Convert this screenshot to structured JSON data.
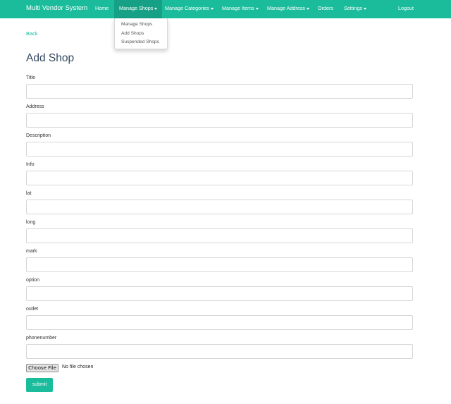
{
  "navbar": {
    "brand": "Multi Vendor System",
    "items": [
      {
        "label": "Home",
        "dropdown": false
      },
      {
        "label": "Manage Shops",
        "dropdown": true,
        "active": true
      },
      {
        "label": "Manage Categories",
        "dropdown": true
      },
      {
        "label": "Manage Items",
        "dropdown": true
      },
      {
        "label": "Manage Address",
        "dropdown": true
      },
      {
        "label": "Orders",
        "dropdown": false
      },
      {
        "label": "Settings",
        "dropdown": true
      }
    ],
    "logout": "Logout"
  },
  "dropdown_menu": {
    "items": [
      "Manage Shops",
      "Add Shops",
      "Suspended Shops"
    ]
  },
  "back_link": "Back",
  "page_title": "Add Shop",
  "form": {
    "fields": [
      {
        "label": "Title",
        "value": ""
      },
      {
        "label": "Address",
        "value": ""
      },
      {
        "label": "Description",
        "value": ""
      },
      {
        "label": "Info",
        "value": ""
      },
      {
        "label": "lat",
        "value": ""
      },
      {
        "label": "long",
        "value": ""
      },
      {
        "label": "mark",
        "value": ""
      },
      {
        "label": "option",
        "value": ""
      },
      {
        "label": "outlet",
        "value": ""
      },
      {
        "label": "phonenumber",
        "value": ""
      }
    ],
    "file_button": "Choose File",
    "file_status": "No file chosen",
    "submit": "submit"
  },
  "colors": {
    "accent": "#1abc9c",
    "accent_dark": "#16a085",
    "title": "#34495e"
  }
}
